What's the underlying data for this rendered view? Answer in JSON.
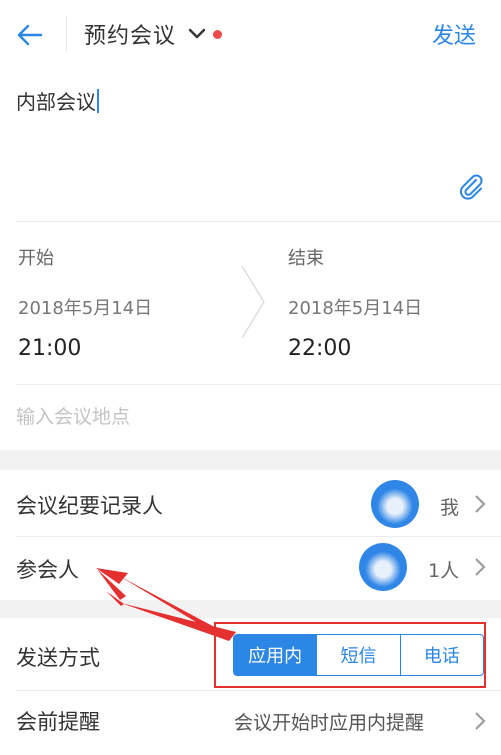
{
  "header": {
    "title": "预约会议",
    "send_label": "发送"
  },
  "subject": {
    "value": "内部会议"
  },
  "schedule": {
    "start_label": "开始",
    "start_date": "2018年5月14日",
    "start_time": "21:00",
    "end_label": "结束",
    "end_date": "2018年5月14日",
    "end_time": "22:00"
  },
  "location": {
    "placeholder": "输入会议地点"
  },
  "recorder": {
    "label": "会议纪要记录人",
    "value": "我"
  },
  "attendees": {
    "label": "参会人",
    "value": "1人"
  },
  "send_method": {
    "label": "发送方式",
    "options": [
      "应用内",
      "短信",
      "电话"
    ],
    "selected": "应用内"
  },
  "reminder": {
    "label": "会前提醒",
    "value": "会议开始时应用内提醒"
  },
  "colors": {
    "accent": "#2b86e6",
    "annotation": "#e53030",
    "unread_dot": "#f04a4a"
  },
  "icons": [
    "back-arrow-icon",
    "chevron-down-icon",
    "paperclip-icon",
    "chevron-right-icon"
  ]
}
